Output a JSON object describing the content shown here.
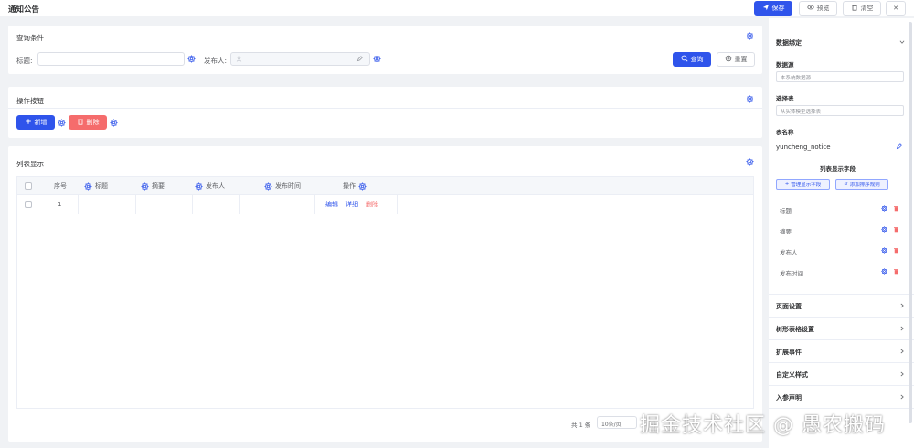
{
  "topbar": {
    "title": "通知公告",
    "save_label": "保存",
    "preview_label": "预览",
    "clear_label": "清空",
    "close_label": "✕"
  },
  "query": {
    "title": "查询条件",
    "title_label": "标题:",
    "publisher_label": "发布人:",
    "search_label": "查询",
    "reset_label": "重置"
  },
  "actions": {
    "title": "操作按钮",
    "add_label": "新增",
    "delete_label": "删除"
  },
  "list": {
    "title": "列表显示",
    "columns": [
      "序号",
      "标题",
      "摘要",
      "发布人",
      "发布时间",
      "操作"
    ],
    "rows": [
      {
        "index": "1",
        "ops": [
          "编辑",
          "详细",
          "删除"
        ]
      }
    ],
    "pagination": {
      "total": "共 1 条",
      "page_size": "10条/页"
    }
  },
  "right_panel": {
    "data_binding_title": "数据绑定",
    "datasource_label": "数据源",
    "datasource_value": "本系统数据源",
    "select_table_label": "选择表",
    "select_table_placeholder": "从实体模型选择表",
    "table_name_label": "表名称",
    "table_name_value": "yuncheng_notice",
    "list_fields_title": "列表显示字段",
    "manage_fields_label": "管理显示字段",
    "add_sort_label": "添加排序规则",
    "fields": [
      "标题",
      "摘要",
      "发布人",
      "发布时间"
    ],
    "sections": [
      "页面设置",
      "树形表格设置",
      "扩展事件",
      "自定义样式",
      "入参声明"
    ]
  },
  "watermark": "掘金技术社区 @ 愚农搬码",
  "colors": {
    "primary": "#2f54eb",
    "danger": "#f56c6c"
  }
}
